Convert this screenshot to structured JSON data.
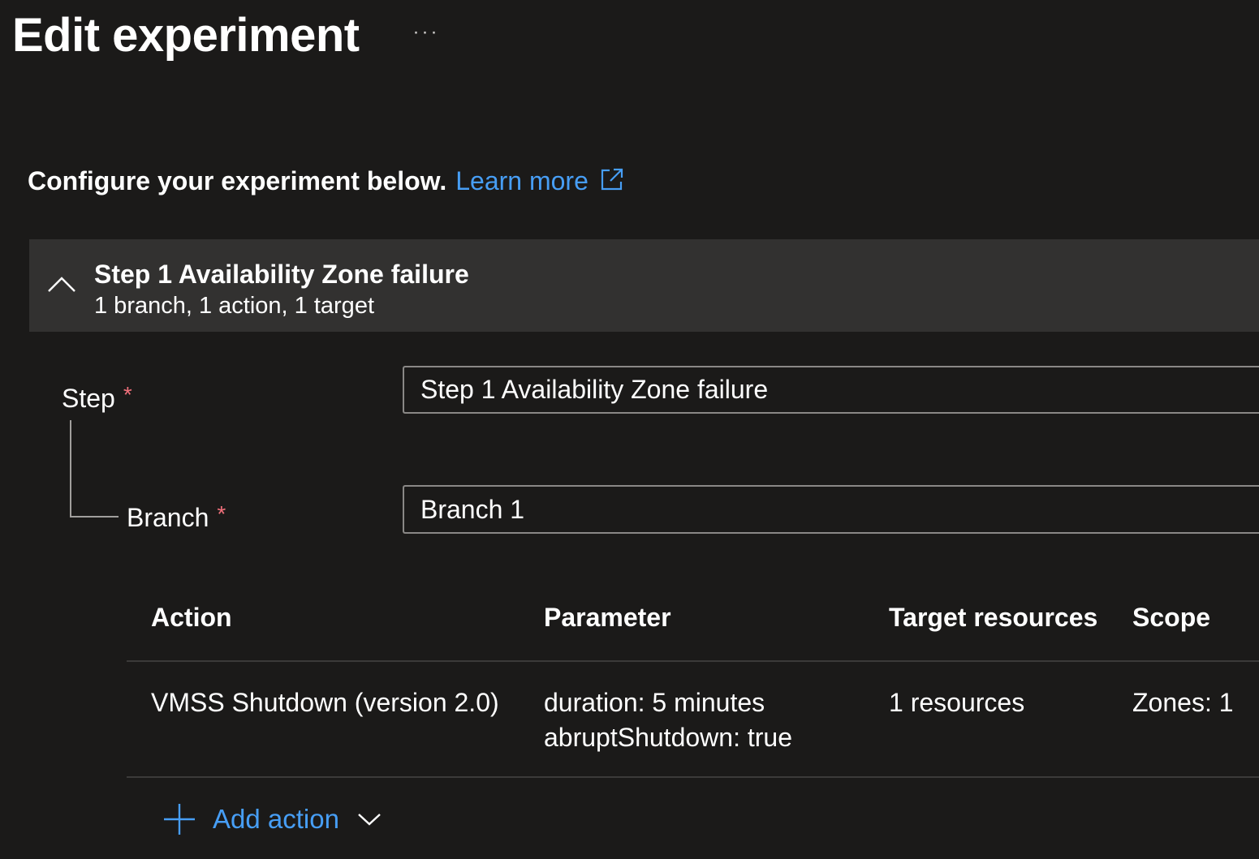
{
  "header": {
    "title": "Edit experiment",
    "more_label": "···"
  },
  "intro": {
    "text": "Configure your experiment below.",
    "learn_more": "Learn more"
  },
  "step_header": {
    "title": "Step 1 Availability Zone failure",
    "subtitle": "1 branch, 1 action, 1 target"
  },
  "form": {
    "step_label": "Step",
    "step_required": "*",
    "step_value": "Step 1 Availability Zone failure",
    "branch_label": "Branch",
    "branch_required": "*",
    "branch_value": "Branch 1"
  },
  "table": {
    "headers": {
      "action": "Action",
      "parameter": "Parameter",
      "target": "Target resources",
      "scope": "Scope"
    },
    "rows": [
      {
        "action": "VMSS Shutdown (version 2.0)",
        "parameter_line1": "duration: 5 minutes",
        "parameter_line2": "abruptShutdown: true",
        "target": "1 resources",
        "scope": "Zones: 1"
      }
    ]
  },
  "add_action": {
    "label": "Add action"
  },
  "colors": {
    "background": "#1b1a19",
    "header_bar": "#323130",
    "link": "#479ef5",
    "required": "#f1707b"
  }
}
